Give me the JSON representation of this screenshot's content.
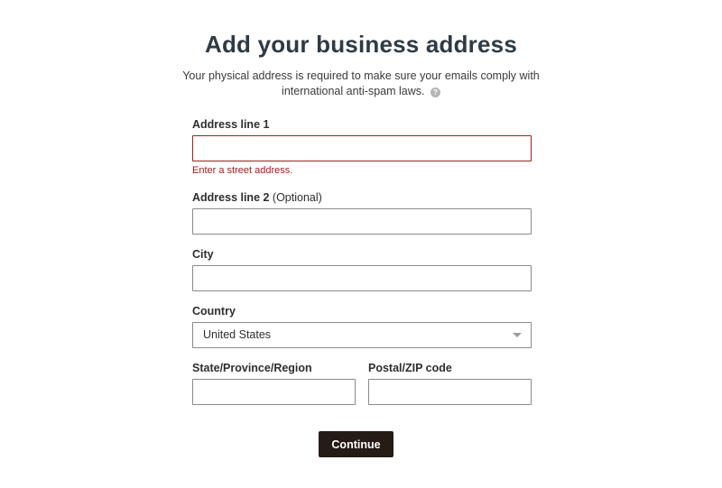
{
  "header": {
    "title": "Add your business address",
    "subtitle": "Your physical address is required to make sure your emails comply with international anti-spam laws.",
    "help_icon_glyph": "?"
  },
  "form": {
    "address1": {
      "label": "Address line 1",
      "value": "",
      "placeholder": "",
      "error": "Enter a street address."
    },
    "address2": {
      "label": "Address line 2",
      "optional": " (Optional)",
      "value": "",
      "placeholder": ""
    },
    "city": {
      "label": "City",
      "value": "",
      "placeholder": ""
    },
    "country": {
      "label": "Country",
      "selected": "United States"
    },
    "state": {
      "label": "State/Province/Region",
      "value": "",
      "placeholder": ""
    },
    "postal": {
      "label": "Postal/ZIP code",
      "value": "",
      "placeholder": ""
    }
  },
  "actions": {
    "continue_label": "Continue"
  },
  "colors": {
    "error": "#9e1f1f",
    "button_bg": "#241c15",
    "title": "#2e3b45"
  }
}
